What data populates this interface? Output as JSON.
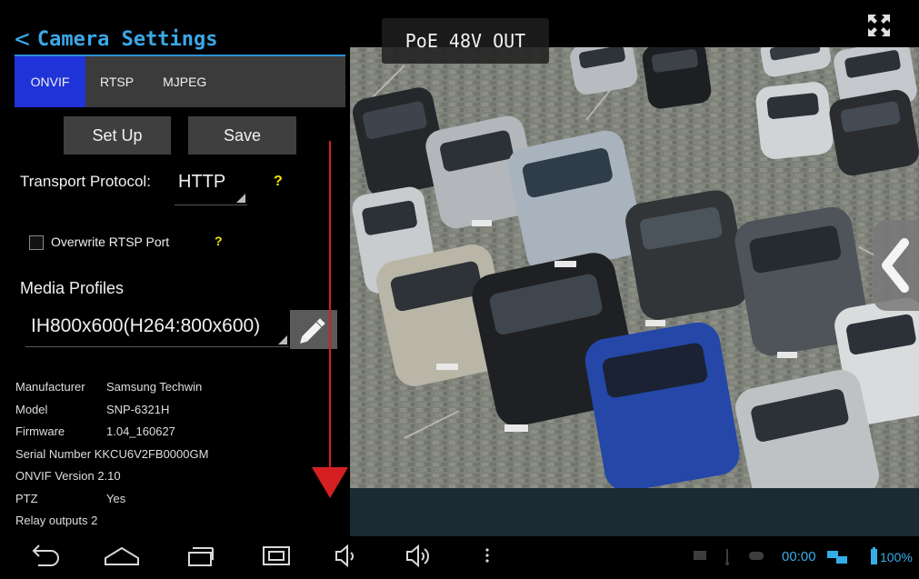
{
  "header": {
    "back_glyph": "<",
    "title": "Camera Settings"
  },
  "overlay": {
    "poe_label": "PoE 48V OUT"
  },
  "tabs": [
    {
      "label": "ONVIF",
      "active": true
    },
    {
      "label": "RTSP",
      "active": false
    },
    {
      "label": "MJPEG",
      "active": false
    }
  ],
  "buttons": {
    "setup": "Set Up",
    "save": "Save"
  },
  "transport": {
    "label": "Transport Protocol:",
    "value": "HTTP",
    "help": "?"
  },
  "rtsp_port": {
    "label": "Overwrite RTSP Port",
    "checked": false,
    "help": "?"
  },
  "media_profiles": {
    "label": "Media Profiles",
    "value": "IH800x600(H264:800x600)"
  },
  "device_info": [
    {
      "key": "Manufacturer",
      "value": "Samsung Techwin"
    },
    {
      "key": "Model",
      "value": "SNP-6321H"
    },
    {
      "key": "Firmware",
      "value": "1.04_160627"
    },
    {
      "key": "Serial Number",
      "value": "KKCU6V2FB0000GM"
    },
    {
      "key": "ONVIF Version",
      "value": "2.10"
    },
    {
      "key": "PTZ",
      "value": "Yes"
    },
    {
      "key": "Relay outputs",
      "value": "2"
    }
  ],
  "statusbar": {
    "time": "00:00",
    "battery": "100%"
  },
  "icons": {
    "back": "back-arrow-icon",
    "home": "home-icon",
    "recents": "recent-apps-icon",
    "screenshot": "screenshot-icon",
    "vol_down": "volume-down-icon",
    "vol_up": "volume-up-icon",
    "menu": "overflow-menu-icon",
    "edit": "pencil-icon",
    "fullscreen": "fullscreen-icon",
    "side_panel": "chevron-left-icon"
  },
  "colors": {
    "accent": "#3aa8e8",
    "active_tab": "#1f33d8",
    "help": "#f5e600",
    "scroll_arrow": "#d42020"
  }
}
